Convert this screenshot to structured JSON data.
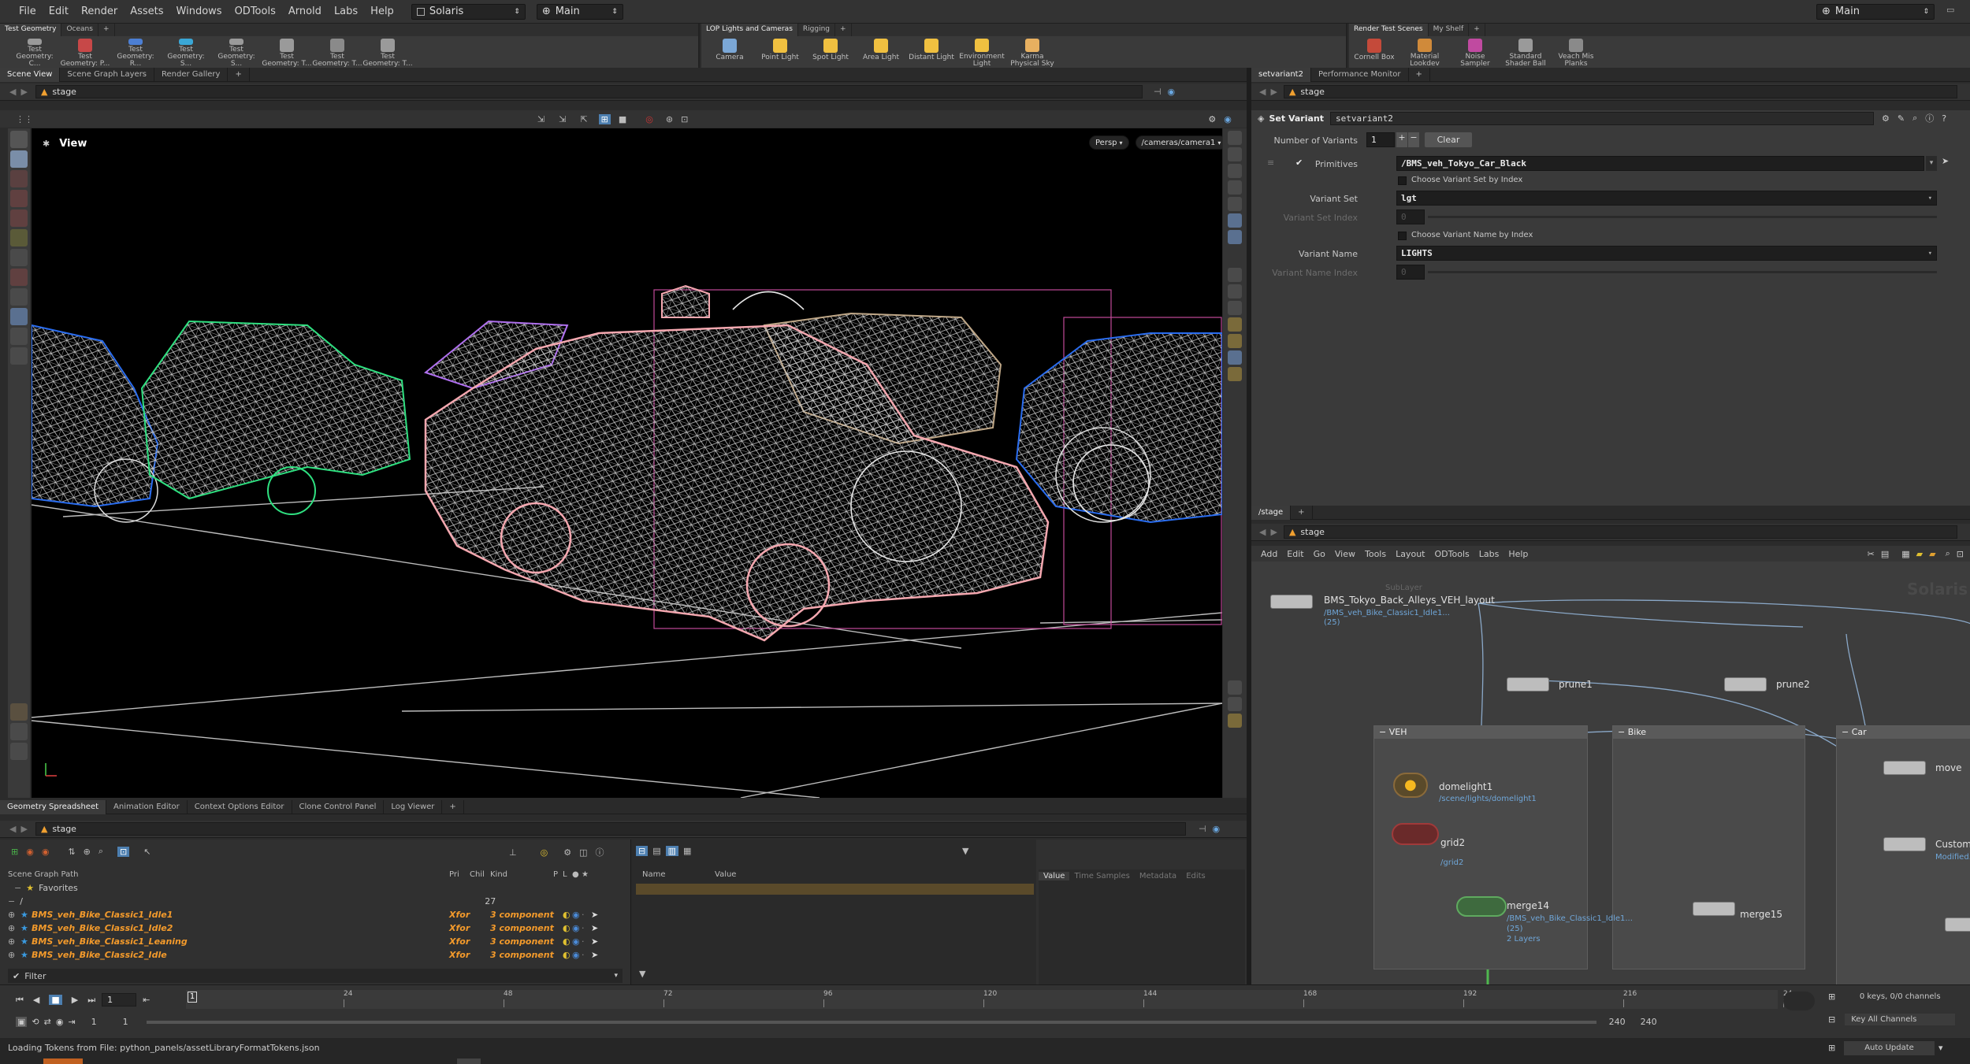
{
  "menu": {
    "items": [
      "File",
      "Edit",
      "Render",
      "Assets",
      "Windows",
      "ODTools",
      "Arnold",
      "Labs",
      "Help"
    ],
    "desktop": "Solaris",
    "context": "Main",
    "right_desktop": "Main"
  },
  "shelf_left": {
    "tabs": [
      "Test Geometry",
      "Oceans"
    ],
    "tools": [
      {
        "label": "Test Geometry: C...",
        "color": "#9a9a9a"
      },
      {
        "label": "Test Geometry: P...",
        "color": "#c74848"
      },
      {
        "label": "Test Geometry: R...",
        "color": "#4c7fd4"
      },
      {
        "label": "Test Geometry: S...",
        "color": "#3aa7d6"
      },
      {
        "label": "Test Geometry: S...",
        "color": "#9a9a9a"
      },
      {
        "label": "Test Geometry: T...",
        "color": "#9a9a9a"
      },
      {
        "label": "Test Geometry: T...",
        "color": "#8a8a8a"
      },
      {
        "label": "Test Geometry: T...",
        "color": "#9a9a9a"
      }
    ]
  },
  "shelf_mid": {
    "tabs": [
      "LOP Lights and Cameras",
      "Rigging"
    ],
    "tools": [
      {
        "label": "Camera",
        "color": "#7ba7d6"
      },
      {
        "label": "Point Light",
        "color": "#f0c040"
      },
      {
        "label": "Spot Light",
        "color": "#f0c040"
      },
      {
        "label": "Area Light",
        "color": "#f0c040"
      },
      {
        "label": "Distant Light",
        "color": "#f0c040"
      },
      {
        "label": "Environment Light",
        "color": "#f0c040"
      },
      {
        "label": "Karma Physical Sky",
        "color": "#e8b060"
      }
    ]
  },
  "shelf_right": {
    "tabs": [
      "Render Test Scenes",
      "My Shelf"
    ],
    "tools": [
      {
        "label": "Cornell Box",
        "color": "#c44a3a"
      },
      {
        "label": "Material Lookdev",
        "color": "#d08a3a"
      },
      {
        "label": "Noise Sampler",
        "color": "#c04aa0"
      },
      {
        "label": "Standard Shader Ball",
        "color": "#9a9a9a"
      },
      {
        "label": "Veach Mis Planks",
        "color": "#8a8a8a"
      }
    ]
  },
  "scene_view": {
    "tabs": [
      "Scene View",
      "Scene Graph Layers",
      "Render Gallery"
    ],
    "path": "stage",
    "view_label": "View",
    "persp": "Persp",
    "camera": "/cameras/camera1"
  },
  "params": {
    "tabs": [
      "setvariant2",
      "Performance Monitor"
    ],
    "path": "stage",
    "node_type": "Set Variant",
    "node_name": "setvariant2",
    "num_variants_label": "Number of Variants",
    "num_variants": "1",
    "clear_label": "Clear",
    "primitives_label": "Primitives",
    "primitives": "/BMS_veh_Tokyo_Car_Black",
    "choose_set_label": "Choose Variant Set by Index",
    "variant_set_label": "Variant Set",
    "variant_set": "lgt",
    "variant_set_index_label": "Variant Set Index",
    "variant_set_index": "0",
    "choose_name_label": "Choose Variant Name by Index",
    "variant_name_label": "Variant Name",
    "variant_name": "LIGHTS",
    "variant_name_index_label": "Variant Name Index",
    "variant_name_index": "0"
  },
  "network": {
    "tab": "/stage",
    "path": "stage",
    "menu": [
      "Add",
      "Edit",
      "Go",
      "View",
      "Tools",
      "Layout",
      "ODTools",
      "Labs",
      "Help"
    ],
    "watermark": "Solaris",
    "sublayer": {
      "type": "SubLayer",
      "name": "BMS_Tokyo_Back_Alleys_VEH_layout",
      "sub": "/BMS_veh_Bike_Classic1_Idle1...",
      "count": "(25)"
    },
    "prune1": "prune1",
    "prune2": "prune2",
    "boxes": [
      "VEH",
      "Bike",
      "Car"
    ],
    "domelight": {
      "name": "domelight1",
      "sub": "/scene/lights/domelight1"
    },
    "grid": {
      "name": "grid2",
      "sub": "/grid2"
    },
    "merge14": {
      "name": "merge14",
      "sub": "/BMS_veh_Bike_Classic1_Idle1...",
      "count": "(25)",
      "layers": "2 Layers"
    },
    "merge15": "merge15",
    "move": "move",
    "custom": {
      "name": "Custom_...",
      "sub": "Modified..."
    }
  },
  "spreadsheet": {
    "tabs": [
      "Geometry Spreadsheet",
      "Animation Editor",
      "Context Options Editor",
      "Clone Control Panel",
      "Log Viewer"
    ],
    "path": "stage",
    "columns": [
      "Scene Graph Path",
      "Pri",
      "Chil",
      "Kind",
      "P",
      "L",
      "●",
      "★"
    ],
    "favorites": "Favorites",
    "root": "/",
    "root_count": "27",
    "rows": [
      {
        "name": "BMS_veh_Bike_Classic1_Idle1",
        "pri": "Xfor",
        "kind": "3 component"
      },
      {
        "name": "BMS_veh_Bike_Classic1_Idle2",
        "pri": "Xfor",
        "kind": "3 component"
      },
      {
        "name": "BMS_veh_Bike_Classic1_Leaning",
        "pri": "Xfor",
        "kind": "3 component"
      },
      {
        "name": "BMS_veh_Bike_Classic2_Idle",
        "pri": "Xfor",
        "kind": "3 component"
      }
    ],
    "filter": "Filter",
    "name_col": "Name",
    "value_col": "Value",
    "detail_tabs": [
      "Value",
      "Time Samples",
      "Metadata",
      "Edits"
    ]
  },
  "timeline": {
    "frame": "1",
    "start": "1",
    "start2": "1",
    "ticks": [
      "24",
      "48",
      "72",
      "96",
      "120",
      "144",
      "168",
      "192",
      "216",
      "24"
    ],
    "end": "240",
    "end2": "240",
    "keys": "0 keys, 0/0 channels",
    "key_all": "Key All Channels",
    "auto_update": "Auto Update"
  },
  "status": {
    "message": "Loading Tokens from File: python_panels/assetLibraryFormatTokens.json"
  }
}
